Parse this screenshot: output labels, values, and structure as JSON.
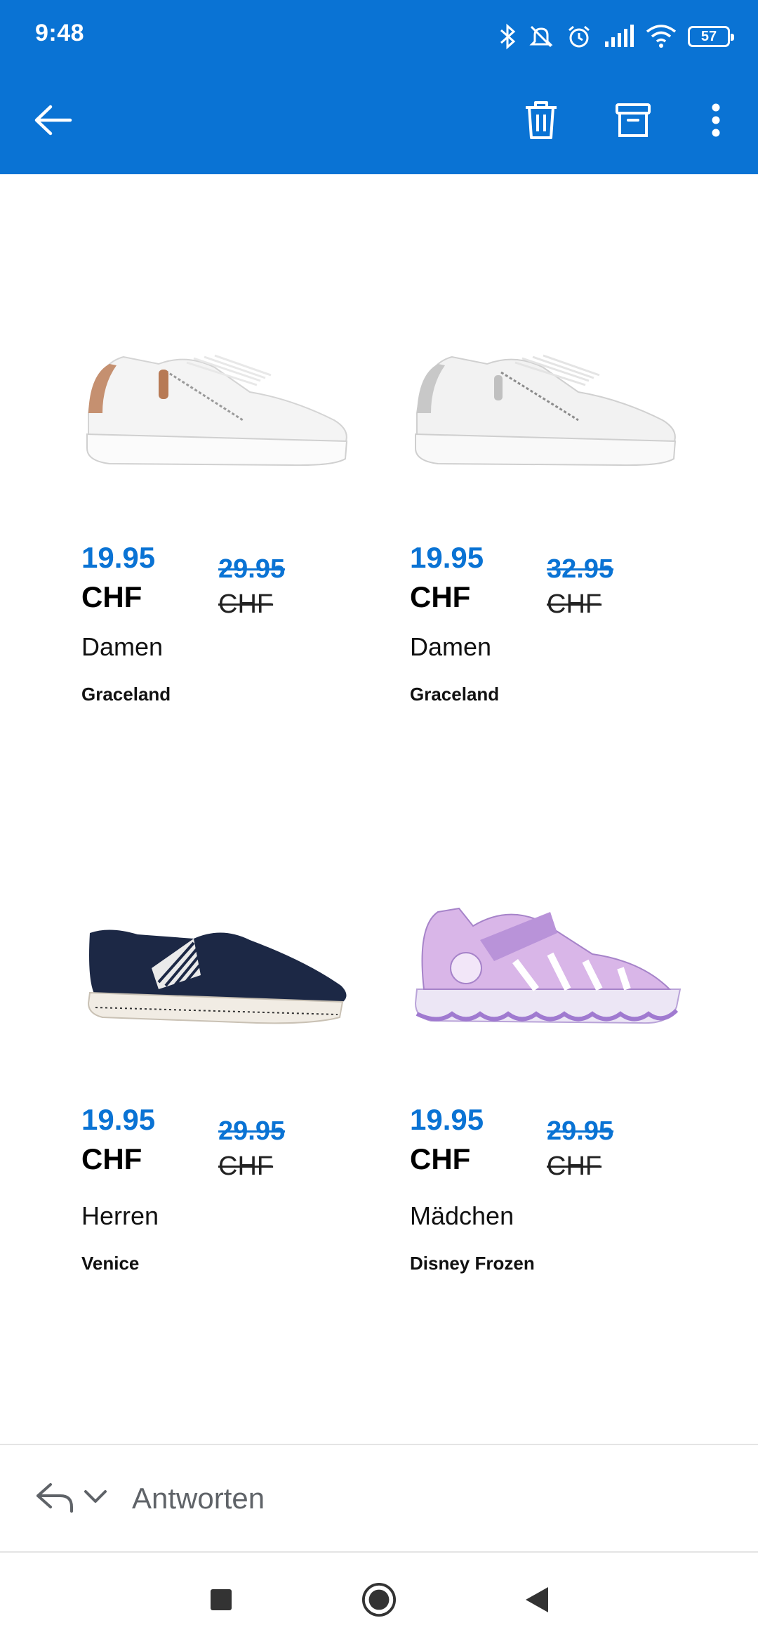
{
  "status": {
    "time": "9:48",
    "battery": "57"
  },
  "toolbar": {
    "back": "back-arrow-icon",
    "delete": "trash-icon",
    "archive": "archive-icon",
    "more": "more-vert-icon"
  },
  "colors": {
    "accent": "#0a73d4",
    "price": "#0a73d4"
  },
  "products": [
    {
      "price": "19.95",
      "currency": "CHF",
      "old_price": "29.95",
      "old_currency": "CHF",
      "category": "Damen",
      "brand": "Graceland",
      "image": "white-sneaker-rose-heel"
    },
    {
      "price": "19.95",
      "currency": "CHF",
      "old_price": "32.95",
      "old_currency": "CHF",
      "category": "Damen",
      "brand": "Graceland",
      "image": "white-sneaker-silver-heel"
    },
    {
      "price": "19.95",
      "currency": "CHF",
      "old_price": "29.95",
      "old_currency": "CHF",
      "category": "Herren",
      "brand": "Venice",
      "image": "navy-slip-on"
    },
    {
      "price": "19.95",
      "currency": "CHF",
      "old_price": "29.95",
      "old_currency": "CHF",
      "category": "Mädchen",
      "brand": "Disney Frozen",
      "image": "purple-frozen-sandal"
    }
  ],
  "reply": {
    "label": "Antworten"
  }
}
